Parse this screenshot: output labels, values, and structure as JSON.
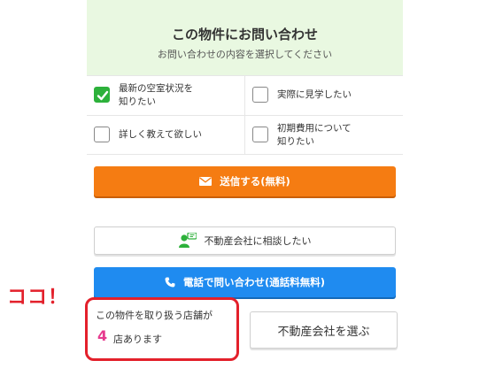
{
  "header": {
    "title": "この物件にお問い合わせ",
    "subtitle": "お問い合わせの内容を選択してください"
  },
  "checkboxes": [
    {
      "label": "最新の空室状況を\n知りたい",
      "checked": true
    },
    {
      "label": "実際に見学したい",
      "checked": false
    },
    {
      "label": "詳しく教えて欲しい",
      "checked": false
    },
    {
      "label": "初期費用について\n知りたい",
      "checked": false
    }
  ],
  "buttons": {
    "send_label": "送信する(無料)",
    "consult_label": "不動産会社に相談したい",
    "phone_label": "電話で問い合わせ(通話料無料)",
    "select_company_label": "不動産会社を選ぶ"
  },
  "stores": {
    "line1": "この物件を取り扱う店舗が",
    "count": "4",
    "suffix": "店あります"
  },
  "annotation": {
    "callout": "ココ！"
  },
  "colors": {
    "accent_green": "#2db13b",
    "send_orange": "#f57c12",
    "phone_blue": "#1f8bf0",
    "highlight_red": "#e3202b",
    "count_pink": "#e63a8e",
    "header_bg": "#e9f8e1"
  },
  "icons": {
    "send": "mail-icon",
    "consult": "chat-person-icon",
    "phone": "phone-icon",
    "checked": "check-icon"
  }
}
